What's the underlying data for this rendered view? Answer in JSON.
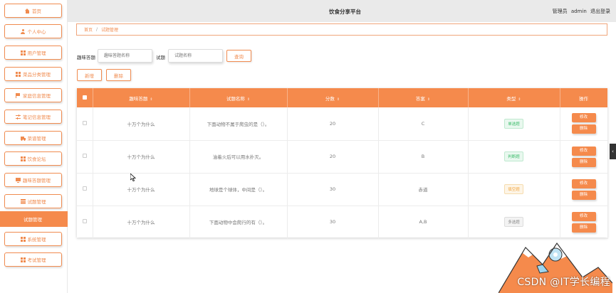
{
  "app": {
    "title": "饮食分享平台"
  },
  "header": {
    "role": "管理员",
    "username": "admin",
    "logout": "退出登录"
  },
  "sidebar": {
    "items": [
      {
        "label": "首页",
        "icon": "home-icon"
      },
      {
        "label": "个人中心",
        "icon": "user-icon"
      },
      {
        "label": "用户管理",
        "icon": "grid-icon"
      },
      {
        "label": "菜品分类管理",
        "icon": "grid-icon"
      },
      {
        "label": "家庭信息管理",
        "icon": "flag-icon"
      },
      {
        "label": "笔记信息管理",
        "icon": "sliders-icon"
      },
      {
        "label": "菜谱管理",
        "icon": "truck-icon"
      },
      {
        "label": "饮食论坛",
        "icon": "grid-icon"
      },
      {
        "label": "趣味答题管理",
        "icon": "monitor-icon"
      },
      {
        "label": "试题管理",
        "icon": "database-icon"
      },
      {
        "label": "试题管理",
        "icon": ""
      },
      {
        "label": "系统管理",
        "icon": "grid-icon"
      },
      {
        "label": "考试管理",
        "icon": "grid-icon"
      }
    ]
  },
  "breadcrumb": {
    "home": "首页",
    "separator": "/",
    "current": "试题管理"
  },
  "search": {
    "bank_label": "趣味答题",
    "bank_placeholder": "趣味答题名称",
    "question_label": "试题",
    "question_placeholder": "试题名称",
    "query_button": "查询"
  },
  "actions": {
    "add": "新增",
    "delete": "删除"
  },
  "table": {
    "columns": [
      "趣味答题",
      "试题名称",
      "分数",
      "答案",
      "类型",
      "操作"
    ],
    "rows": [
      {
        "bank": "十万个为什么",
        "name": "下面动物不属于爬虫的是（）。",
        "score": "20",
        "answer": "C",
        "type": "单选题",
        "type_color": "green"
      },
      {
        "bank": "十万个为什么",
        "name": "油着火后可以用水扑灭。",
        "score": "20",
        "answer": "B",
        "type": "判断题",
        "type_color": "green"
      },
      {
        "bank": "十万个为什么",
        "name": "地球是个球体，中间是（）。",
        "score": "30",
        "answer": "赤道",
        "type": "填空题",
        "type_color": "orange"
      },
      {
        "bank": "十万个为什么",
        "name": "下面动物中会爬行的有（）。",
        "score": "30",
        "answer": "A,B",
        "type": "多选题",
        "type_color": "gray"
      }
    ],
    "edit_label": "修改",
    "delete_label": "删除"
  },
  "watermark": "CSDN @IT学长编程",
  "colors": {
    "accent": "#f58a4c",
    "header_bg": "#eaeaea"
  }
}
